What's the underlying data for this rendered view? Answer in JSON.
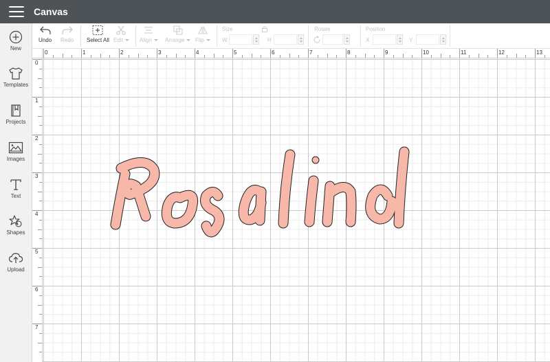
{
  "header": {
    "title": "Canvas"
  },
  "sidebar": {
    "items": [
      {
        "label": "New",
        "icon": "plus-circle-icon"
      },
      {
        "label": "Templates",
        "icon": "tshirt-icon"
      },
      {
        "label": "Projects",
        "icon": "bookmark-book-icon"
      },
      {
        "label": "Images",
        "icon": "image-icon"
      },
      {
        "label": "Text",
        "icon": "text-t-icon"
      },
      {
        "label": "Shapes",
        "icon": "shapes-icon"
      },
      {
        "label": "Upload",
        "icon": "cloud-upload-icon"
      }
    ]
  },
  "toolbar": {
    "undo": "Undo",
    "redo": "Redo",
    "select_all": "Select All",
    "edit": "Edit",
    "align": "Align",
    "arrange": "Arrange",
    "flip": "Flip",
    "size_label": "Size",
    "w_label": "W",
    "h_label": "H",
    "rotate_label": "Rotate",
    "position_label": "Position",
    "x_label": "X",
    "y_label": "Y"
  },
  "rulers": {
    "top": [
      "0",
      "1",
      "2",
      "3",
      "4",
      "5",
      "6",
      "7",
      "8",
      "9",
      "10",
      "11",
      "12",
      "13"
    ],
    "left": [
      "0",
      "1",
      "2",
      "3",
      "4",
      "5",
      "6",
      "7"
    ]
  },
  "canvas": {
    "text": "Rosalind",
    "fill_color": "#f7b8aa",
    "stroke_color": "#222222"
  },
  "colors": {
    "header_bg": "#4e5358",
    "sidebar_bg": "#f1f1f1"
  }
}
